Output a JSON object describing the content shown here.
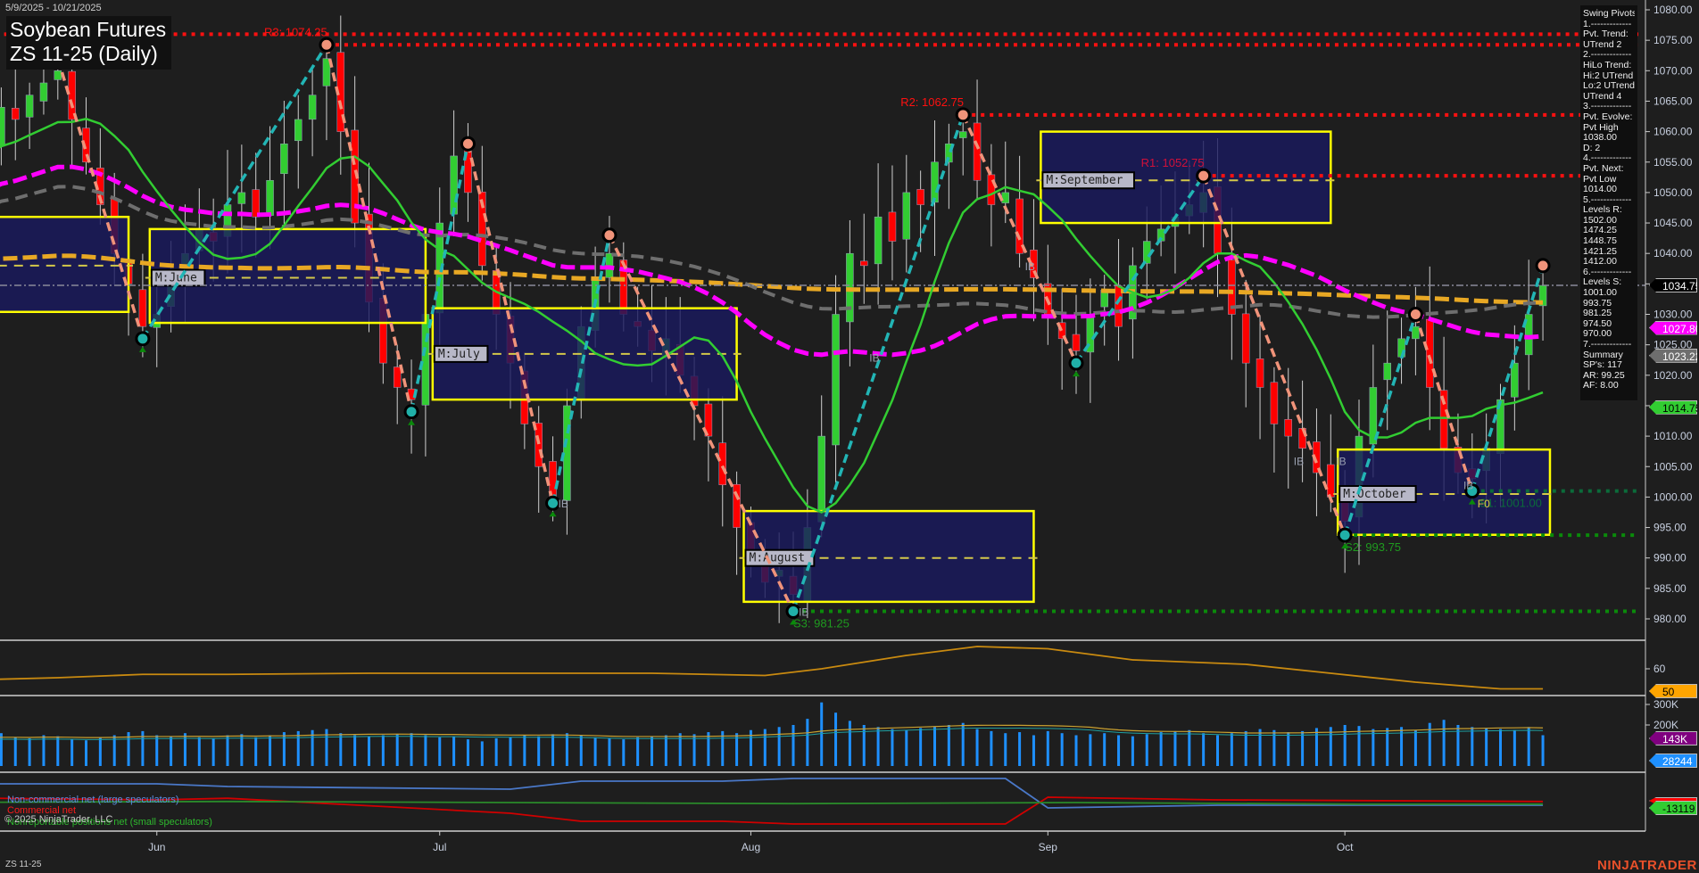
{
  "header": {
    "date_range": "5/9/2025 - 10/21/2025",
    "title": "Soybean Futures",
    "subtitle": "ZS 11-25 (Daily)"
  },
  "info_panel": {
    "lines": [
      "Swing Pivots",
      "1.-------------",
      "Pvt. Trend:",
      "UTrend 2",
      "2.-------------",
      "HiLo Trend:",
      "Hi:2 UTrend",
      "Lo:2 UTrend",
      "UTrend 4",
      "3.-------------",
      "Pvt. Evolve:",
      "Pvt High",
      "1038.00",
      "D: 2",
      "4.-------------",
      "Pvt. Next:",
      "Pvt Low",
      "1014.00",
      "5.-------------",
      "Levels R:",
      "1502.00",
      "1474.25",
      "1448.75",
      "1421.25",
      "1412.00",
      "6.-------------",
      "Levels S:",
      "1001.00",
      "993.75",
      "981.25",
      "974.50",
      "970.00",
      "7.-------------",
      "Summary",
      "SP's: 117",
      "AR: 99.25",
      "AF: 8.00"
    ]
  },
  "price_tags": [
    {
      "label": "1034.75",
      "value": 1034.75,
      "bg": "#000000",
      "fg": "#ffffff"
    },
    {
      "label": "1027.80",
      "value": 1027.8,
      "bg": "#ff00ff",
      "fg": "#ffffff"
    },
    {
      "label": "1023.22",
      "value": 1023.22,
      "bg": "#6e6e6e",
      "fg": "#ffffff"
    },
    {
      "label": "1014.75",
      "value": 1014.75,
      "bg": "#32cd32",
      "fg": "#000000"
    }
  ],
  "panel_tags": {
    "osc": {
      "label": "50",
      "bg": "#ffa500",
      "fg": "#000000"
    },
    "vol_ma": {
      "label": "143K",
      "bg": "#800080",
      "fg": "#ffffff"
    },
    "vol": {
      "label": "28244",
      "bg": "#1e90ff",
      "fg": "#ffffff"
    },
    "cot_small": {
      "label": "-13119",
      "bg": "#32cd32",
      "fg": "#000000"
    }
  },
  "legend": {
    "noncommercial": "Non-commercial net (large speculators)",
    "commercial": "Commercial net",
    "nonreportable": "Nonreportable positions net (small speculators)"
  },
  "footer": {
    "copyright": "© 2025 NinjaTrader, LLC",
    "instrument": "ZS 11-25",
    "brand": "NINJATRADER"
  },
  "colors": {
    "up": "#32cd32",
    "down": "#ff0000",
    "resistance": "#ff0000",
    "support": "#008000",
    "box": "#1a1a5e",
    "box_border": "#ffff00",
    "zig_up": "#22b5b5",
    "zig_down": "#f0937a"
  },
  "chart_data": {
    "type": "candlestick",
    "title": "Soybean Futures ZS 11-25 (Daily)",
    "ylim": [
      976,
      1082
    ],
    "y_ticks": [
      980,
      985,
      990,
      995,
      1000,
      1005,
      1010,
      1015,
      1020,
      1025,
      1030,
      1035,
      1040,
      1045,
      1050,
      1055,
      1060,
      1065,
      1070,
      1075,
      1080
    ],
    "x_labels": [
      {
        "label": "Jun",
        "idx": 15
      },
      {
        "label": "Jul",
        "idx": 35
      },
      {
        "label": "Aug",
        "idx": 57
      },
      {
        "label": "Sep",
        "idx": 78
      },
      {
        "label": "Oct",
        "idx": 99
      }
    ],
    "closes": [
      1050,
      1056,
      1060,
      1058,
      1064,
      1062,
      1066,
      1068,
      1070,
      1062,
      1055,
      1048,
      1040,
      1035,
      1028,
      1030,
      1036,
      1040,
      1044,
      1042,
      1048,
      1050,
      1046,
      1052,
      1058,
      1062,
      1066,
      1072,
      1060,
      1045,
      1032,
      1022,
      1018,
      1016,
      1030,
      1045,
      1056,
      1050,
      1038,
      1030,
      1022,
      1012,
      1005,
      1000,
      1015,
      1028,
      1036,
      1040,
      1030,
      1028,
      1024,
      1026,
      1020,
      1015,
      1010,
      1002,
      995,
      990,
      986,
      988,
      984,
      995,
      1010,
      1030,
      1040,
      1038,
      1046,
      1042,
      1050,
      1048,
      1055,
      1058,
      1060,
      1052,
      1048,
      1050,
      1040,
      1036,
      1030,
      1026,
      1024,
      1030,
      1034,
      1028,
      1038,
      1042,
      1044,
      1046,
      1048,
      1050,
      1040,
      1030,
      1022,
      1018,
      1012,
      1010,
      1008,
      1004,
      1000,
      996,
      1010,
      1018,
      1022,
      1026,
      1028,
      1018,
      1008,
      1004,
      1003,
      1008,
      1016,
      1022,
      1030,
      1034.75
    ],
    "levels": [
      {
        "label": "R4: 1076.00",
        "price": 1076.0,
        "from_idx": -4,
        "kind": "resistance"
      },
      {
        "label": "R3: 1074.25",
        "price": 1074.25,
        "from_idx": 27,
        "kind": "resistance"
      },
      {
        "label": "R2: 1062.75",
        "price": 1062.75,
        "from_idx": 72,
        "kind": "resistance"
      },
      {
        "label": "R1: 1052.75",
        "price": 1052.75,
        "from_idx": 89,
        "kind": "r1"
      },
      {
        "label": "S1: 1001.00",
        "price": 1001.0,
        "from_idx": 108,
        "kind": "s1"
      },
      {
        "label": "S2: 993.75",
        "price": 993.75,
        "from_idx": 99,
        "kind": "support"
      },
      {
        "label": "S3: 981.25",
        "price": 981.25,
        "from_idx": 60,
        "kind": "support"
      }
    ],
    "current_price": 1034.75,
    "zigzag": [
      {
        "idx": 8,
        "price": 1072,
        "type": "high"
      },
      {
        "idx": 14,
        "price": 1026,
        "type": "low"
      },
      {
        "idx": 27,
        "price": 1074.25,
        "type": "high"
      },
      {
        "idx": 33,
        "price": 1014,
        "type": "low"
      },
      {
        "idx": 37,
        "price": 1058,
        "type": "high"
      },
      {
        "idx": 43,
        "price": 999,
        "type": "low"
      },
      {
        "idx": 47,
        "price": 1043,
        "type": "high"
      },
      {
        "idx": 60,
        "price": 981.25,
        "type": "low"
      },
      {
        "idx": 72,
        "price": 1062.75,
        "type": "high"
      },
      {
        "idx": 80,
        "price": 1022,
        "type": "low"
      },
      {
        "idx": 89,
        "price": 1052.75,
        "type": "high"
      },
      {
        "idx": 99,
        "price": 993.75,
        "type": "low"
      },
      {
        "idx": 104,
        "price": 1030,
        "type": "high"
      },
      {
        "idx": 108,
        "price": 1001,
        "type": "low"
      },
      {
        "idx": 113,
        "price": 1038,
        "type": "high"
      }
    ],
    "monthly_boxes": [
      {
        "label": "",
        "from_idx": -5,
        "to_idx": 13,
        "high": 1046,
        "low": 1030.4,
        "mid": 1038
      },
      {
        "label": "M:June",
        "from_idx": 14.5,
        "to_idx": 34,
        "high": 1044,
        "low": 1028.6,
        "mid": 1036
      },
      {
        "label": "M:July",
        "from_idx": 34.5,
        "to_idx": 56,
        "high": 1031,
        "low": 1016,
        "mid": 1023.5
      },
      {
        "label": "M:August",
        "from_idx": 56.5,
        "to_idx": 77,
        "high": 997.7,
        "low": 982.8,
        "mid": 990
      },
      {
        "label": "M:September",
        "from_idx": 77.5,
        "to_idx": 98,
        "high": 1060,
        "low": 1045,
        "mid": 1052
      },
      {
        "label": "M:October",
        "from_idx": 98.5,
        "to_idx": 113.5,
        "high": 1007.8,
        "low": 993.8,
        "mid": 1000.5
      }
    ],
    "annotations": [
      {
        "label": "IB",
        "idx": 43,
        "price": 999
      },
      {
        "label": "IB",
        "idx": 60,
        "price": 981.25
      },
      {
        "label": "IB",
        "idx": 76,
        "price": 1038
      },
      {
        "label": "IB",
        "idx": 65,
        "price": 1023
      },
      {
        "label": "IB",
        "idx": 95,
        "price": 1006
      },
      {
        "label": "IB",
        "idx": 98,
        "price": 1006
      },
      {
        "label": "IB",
        "idx": 107,
        "price": 1002
      },
      {
        "label": "F0",
        "idx": 108,
        "price": 999
      }
    ],
    "oscillator": {
      "ylim": [
        40,
        75
      ],
      "ticks": [
        60
      ],
      "points": [
        [
          -4,
          57
        ],
        [
          2,
          55
        ],
        [
          8,
          56
        ],
        [
          14,
          57.5
        ],
        [
          20,
          57.5
        ],
        [
          30,
          58
        ],
        [
          50,
          58
        ],
        [
          58,
          57
        ],
        [
          62,
          60
        ],
        [
          68,
          66
        ],
        [
          73,
          70
        ],
        [
          78,
          69
        ],
        [
          84,
          64
        ],
        [
          92,
          62
        ],
        [
          98,
          58
        ],
        [
          104,
          54
        ],
        [
          110,
          51
        ],
        [
          113,
          51
        ]
      ]
    },
    "volume": {
      "ylim": [
        0,
        330
      ],
      "ticks": [
        "300K",
        "200K"
      ],
      "values_k": [
        120,
        140,
        150,
        130,
        160,
        140,
        135,
        150,
        145,
        130,
        125,
        140,
        150,
        165,
        170,
        150,
        145,
        160,
        140,
        135,
        150,
        155,
        140,
        150,
        165,
        170,
        175,
        180,
        160,
        150,
        145,
        150,
        155,
        160,
        150,
        140,
        145,
        130,
        120,
        135,
        140,
        150,
        145,
        155,
        160,
        150,
        140,
        135,
        130,
        140,
        145,
        150,
        160,
        155,
        165,
        170,
        160,
        175,
        180,
        190,
        200,
        230,
        310,
        260,
        220,
        200,
        190,
        180,
        175,
        185,
        190,
        200,
        210,
        180,
        170,
        160,
        165,
        150,
        170,
        160,
        150,
        155,
        160,
        150,
        145,
        155,
        165,
        170,
        175,
        160,
        150,
        160,
        170,
        180,
        175,
        165,
        170,
        185,
        190,
        200,
        195,
        180,
        185,
        190,
        175,
        210,
        225,
        200,
        190,
        185,
        180,
        175,
        190,
        150
      ]
    },
    "cot": {
      "noncommercial": [
        [
          -4,
          0.85
        ],
        [
          15,
          0.85
        ],
        [
          20,
          0.8
        ],
        [
          40,
          0.75
        ],
        [
          45,
          0.9
        ],
        [
          55,
          0.9
        ],
        [
          60,
          0.95
        ],
        [
          75,
          0.95
        ],
        [
          78,
          0.4
        ],
        [
          90,
          0.45
        ],
        [
          113,
          0.45
        ]
      ],
      "commercial": [
        [
          -4,
          0.6
        ],
        [
          15,
          0.55
        ],
        [
          20,
          0.58
        ],
        [
          40,
          0.3
        ],
        [
          45,
          0.15
        ],
        [
          55,
          0.15
        ],
        [
          60,
          0.1
        ],
        [
          75,
          0.1
        ],
        [
          78,
          0.6
        ],
        [
          90,
          0.55
        ],
        [
          113,
          0.52
        ]
      ],
      "nonreportable": [
        [
          -4,
          0.5
        ],
        [
          20,
          0.52
        ],
        [
          40,
          0.5
        ],
        [
          60,
          0.48
        ],
        [
          80,
          0.5
        ],
        [
          100,
          0.47
        ],
        [
          113,
          0.47
        ]
      ]
    }
  }
}
